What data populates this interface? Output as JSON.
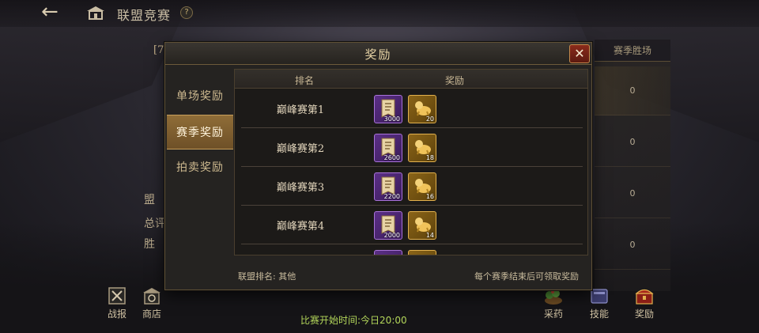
{
  "top_bar": {
    "back_icon": "back-arrow-icon",
    "title": "联盟竞赛",
    "help_icon": "help-icon"
  },
  "background": {
    "bracket_text": "[78",
    "side_labels": [
      "盟",
      "总评",
      "胜"
    ],
    "table_header": "赛季胜场",
    "wins_values": [
      "0",
      "0",
      "0",
      "0"
    ],
    "bottom_left": [
      {
        "label": "战报",
        "icon": "battle-report-icon"
      },
      {
        "label": "商店",
        "icon": "shop-icon"
      }
    ],
    "bottom_right": [
      {
        "label": "采药",
        "icon": "herb-icon"
      },
      {
        "label": "技能",
        "icon": "skill-book-icon"
      },
      {
        "label": "奖励",
        "icon": "reward-chest-icon"
      }
    ],
    "match_time": "比赛开始时间:今日20:00"
  },
  "modal": {
    "title": "奖励",
    "close_icon": "close-icon",
    "tabs": [
      {
        "label": "单场奖励",
        "active": false
      },
      {
        "label": "赛季奖励",
        "active": true
      },
      {
        "label": "拍卖奖励",
        "active": false
      }
    ],
    "table": {
      "headers": {
        "rank": "排名",
        "reward": "奖励"
      },
      "rows": [
        {
          "rank": "巅峰赛第1",
          "item1_qty": "3000",
          "item2_qty": "20"
        },
        {
          "rank": "巅峰赛第2",
          "item1_qty": "2600",
          "item2_qty": "18"
        },
        {
          "rank": "巅峰赛第3",
          "item1_qty": "2200",
          "item2_qty": "16"
        },
        {
          "rank": "巅峰赛第4",
          "item1_qty": "2000",
          "item2_qty": "14"
        }
      ],
      "item_icons": [
        "token-icon",
        "golden-beast-icon"
      ],
      "item_colors": {
        "purple": "#5b2f86",
        "gold": "#8a6418"
      }
    },
    "footer_left": "联盟排名: 其他",
    "footer_right": "每个赛季结束后可领取奖励"
  }
}
